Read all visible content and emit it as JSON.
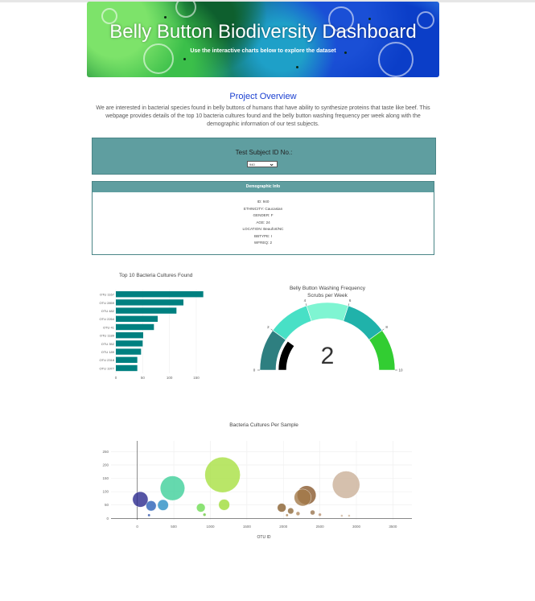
{
  "header": {
    "title": "Belly Button Biodiversity Dashboard",
    "subtitle": "Use the interactive charts below to explore the dataset"
  },
  "overview": {
    "title": "Project Overview",
    "text": "We are interested in bacterial species found in belly buttons of humans that have ability to synthesize proteins that taste like beef. This webpage provides details of the top 10 bacteria cultures found and the belly button washing frequency per week along with the demographic information of our test subjects."
  },
  "selector": {
    "label": "Test Subject ID No.:",
    "selected": "940"
  },
  "demographic": {
    "title": "Demographic Info",
    "rows": [
      "ID: 940",
      "ETHNICITY: Caucasian",
      "GENDER: F",
      "AGE: 24",
      "LOCATION: Beaufort/NC",
      "BBTYPE: I",
      "WFREQ: 2"
    ]
  },
  "colors": {
    "panel": "#5f9ea0",
    "bar": "#008080",
    "gauge_needle": "#000000",
    "title_blue": "#1a3fd0"
  },
  "chart_data": [
    {
      "type": "bar",
      "orientation": "horizontal",
      "title": "Top 10 Bacteria Cultures Found",
      "categories": [
        "OTU 1167",
        "OTU 2859",
        "OTU 482",
        "OTU 2264",
        "OTU 41",
        "OTU 1189",
        "OTU 352",
        "OTU 189",
        "OTU 2318",
        "OTU 1977"
      ],
      "values": [
        163,
        126,
        113,
        78,
        71,
        51,
        50,
        47,
        40,
        40
      ],
      "xticks": [
        0,
        50,
        100,
        150
      ],
      "xlim": [
        0,
        165
      ],
      "color": "#008080"
    },
    {
      "type": "gauge",
      "title": "Belly Button Washing Frequency",
      "subtitle": "Scrubs per Week",
      "value": 2,
      "range": [
        0,
        10
      ],
      "ticks": [
        0,
        2,
        4,
        6,
        8,
        10
      ],
      "bands": [
        {
          "from": 0,
          "to": 2,
          "color": "#2e7f80"
        },
        {
          "from": 2,
          "to": 4,
          "color": "#48e0c6"
        },
        {
          "from": 4,
          "to": 6,
          "color": "#7ff5d2"
        },
        {
          "from": 6,
          "to": 8,
          "color": "#20b2aa"
        },
        {
          "from": 8,
          "to": 10,
          "color": "#32cd32"
        }
      ]
    },
    {
      "type": "scatter",
      "title": "Bacteria Cultures Per Sample",
      "xlabel": "OTU ID",
      "xticks": [
        0,
        500,
        1000,
        1500,
        2000,
        2500,
        3000,
        3500
      ],
      "yticks": [
        0,
        50,
        100,
        150,
        200,
        250
      ],
      "xlim": [
        -360,
        3760
      ],
      "ylim": [
        -5,
        290
      ],
      "points": [
        {
          "x": 41,
          "y": 71,
          "color": "#2c2a8f"
        },
        {
          "x": 189,
          "y": 47,
          "color": "#2a62b8"
        },
        {
          "x": 352,
          "y": 50,
          "color": "#2c8ec4"
        },
        {
          "x": 482,
          "y": 113,
          "color": "#3fcf9a"
        },
        {
          "x": 1167,
          "y": 163,
          "color": "#a8e042"
        },
        {
          "x": 1189,
          "y": 51,
          "color": "#9fdc38"
        },
        {
          "x": 870,
          "y": 40,
          "color": "#6fdc52"
        },
        {
          "x": 2318,
          "y": 87,
          "color": "#8a5a2e"
        },
        {
          "x": 2264,
          "y": 78,
          "color": "#a47a4a"
        },
        {
          "x": 1977,
          "y": 40,
          "color": "#8a6030"
        },
        {
          "x": 2859,
          "y": 126,
          "color": "#cbb098"
        },
        {
          "x": 2100,
          "y": 28,
          "color": "#8e6a3c"
        },
        {
          "x": 2400,
          "y": 22,
          "color": "#9a7650"
        },
        {
          "x": 2200,
          "y": 18,
          "color": "#b08a60"
        },
        {
          "x": 160,
          "y": 12,
          "color": "#2a4fa8"
        },
        {
          "x": 920,
          "y": 14,
          "color": "#6ac840"
        },
        {
          "x": 2050,
          "y": 12,
          "color": "#a88050"
        },
        {
          "x": 2500,
          "y": 14,
          "color": "#b89070"
        },
        {
          "x": 2800,
          "y": 10,
          "color": "#d0b8a0"
        },
        {
          "x": 2900,
          "y": 10,
          "color": "#d0b8a0"
        }
      ]
    }
  ]
}
